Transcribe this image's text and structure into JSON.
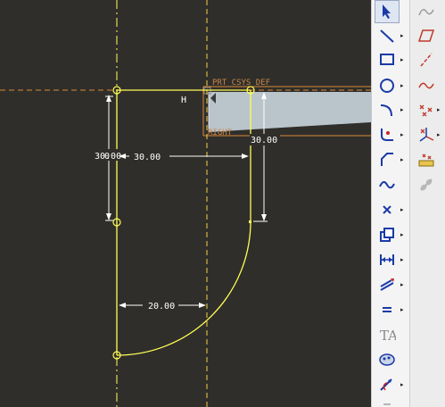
{
  "sketch": {
    "csys_label": "PRT_CSYS_DEF",
    "right_label": "RIGHT",
    "h_marker": "H",
    "dimensions": {
      "height_left": "30.00",
      "width_top": "30.00",
      "height_right": "30.00",
      "width_bottom": "20.00"
    }
  },
  "toolbar": {
    "tools": [
      {
        "name": "select-arrow-icon"
      },
      {
        "name": "line-tool-icon"
      },
      {
        "name": "rectangle-tool-icon"
      },
      {
        "name": "circle-tool-icon"
      },
      {
        "name": "arc-tool-icon"
      },
      {
        "name": "fillet-tool-icon"
      },
      {
        "name": "chamfer-tool-icon"
      },
      {
        "name": "spline-tool-icon"
      },
      {
        "name": "point-tool-icon"
      },
      {
        "name": "offset-edge-icon"
      },
      {
        "name": "dimension-tool-icon"
      },
      {
        "name": "modify-tool-icon"
      },
      {
        "name": "constraint-tool-icon"
      },
      {
        "name": "text-tool-icon"
      },
      {
        "name": "palette-tool-icon"
      },
      {
        "name": "trim-tool-icon"
      }
    ],
    "secondary_tools": [
      {
        "name": "sketch-curve-icon"
      },
      {
        "name": "datum-plane-icon"
      },
      {
        "name": "datum-axis-icon"
      },
      {
        "name": "datum-curve-icon"
      },
      {
        "name": "datum-point-icon"
      },
      {
        "name": "datum-csys-icon"
      },
      {
        "name": "analysis-icon"
      },
      {
        "name": "chain-icon"
      }
    ]
  },
  "colors": {
    "background": "#302e2a",
    "sketch": "#ffff55",
    "reference": "#d98a3a",
    "dimension": "#ffffff",
    "surface": "#b9c4cb"
  }
}
